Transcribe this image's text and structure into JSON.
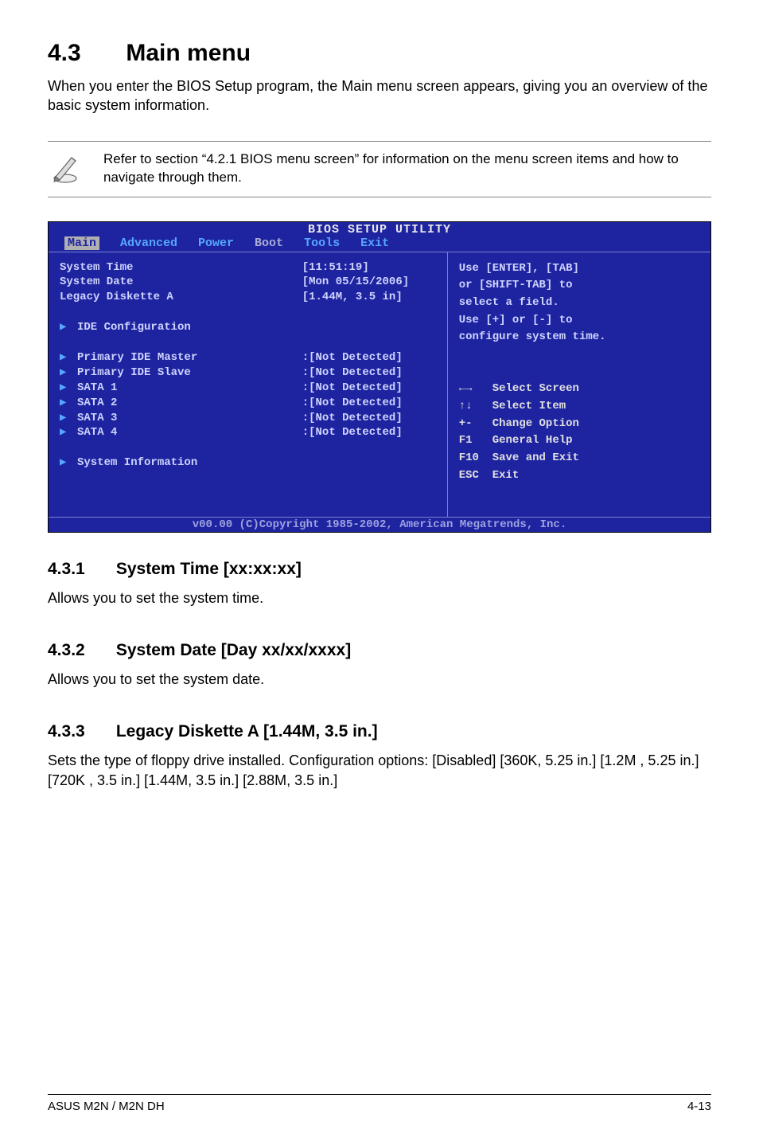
{
  "main": {
    "heading_num": "4.3",
    "heading_title": "Main menu",
    "intro": "When you enter the BIOS Setup program, the Main menu screen appears, giving you an overview of the basic system information."
  },
  "note": {
    "text": "Refer to section “4.2.1  BIOS menu screen” for information on the menu screen items and how to navigate through them."
  },
  "bios": {
    "title": "BIOS SETUP UTILITY",
    "tabs": [
      "Main",
      "Advanced",
      "Power",
      "Boot",
      "Tools",
      "Exit"
    ],
    "rows_top": [
      {
        "label": "System Time",
        "val": "[11:51:19]"
      },
      {
        "label": "System Date",
        "val": "[Mon 05/15/2006]"
      },
      {
        "label": "Legacy Diskette A",
        "val": "[1.44M, 3.5 in]"
      }
    ],
    "row_ide": {
      "label": "IDE Configuration"
    },
    "rows_dev": [
      {
        "label": "Primary IDE Master",
        "val": ":[Not Detected]"
      },
      {
        "label": "Primary IDE Slave",
        "val": ":[Not Detected]"
      },
      {
        "label": "SATA 1",
        "val": ":[Not Detected]"
      },
      {
        "label": "SATA 2",
        "val": ":[Not Detected]"
      },
      {
        "label": "SATA 3",
        "val": ":[Not Detected]"
      },
      {
        "label": "SATA 4",
        "val": ":[Not Detected]"
      }
    ],
    "row_sys": {
      "label": "System Information"
    },
    "help": {
      "lines": [
        "Use [ENTER], [TAB]",
        "or [SHIFT-TAB] to",
        "select a field.",
        "Use [+] or [-] to",
        "configure system time."
      ],
      "keys": [
        {
          "k": "←→",
          "d": "Select Screen"
        },
        {
          "k": "↑↓",
          "d": "Select Item"
        },
        {
          "k": "+-",
          "d": "Change Option"
        },
        {
          "k": "F1",
          "d": "General Help"
        },
        {
          "k": "F10",
          "d": "Save and Exit"
        },
        {
          "k": "ESC",
          "d": "Exit"
        }
      ]
    },
    "footer": "v00.00 (C)Copyright 1985-2002, American Megatrends, Inc."
  },
  "sections": [
    {
      "num": "4.3.1",
      "title": "System Time [xx:xx:xx]",
      "body": "Allows you to set the system time."
    },
    {
      "num": "4.3.2",
      "title": "System Date [Day xx/xx/xxxx]",
      "body": "Allows you to set the system date."
    },
    {
      "num": "4.3.3",
      "title": "Legacy Diskette A [1.44M, 3.5 in.]",
      "body": "Sets the type of floppy drive installed. Configuration options: [Disabled] [360K, 5.25 in.] [1.2M , 5.25 in.] [720K , 3.5 in.] [1.44M, 3.5 in.] [2.88M, 3.5 in.]"
    }
  ],
  "footer": {
    "left": "ASUS M2N / M2N DH",
    "right": "4-13"
  }
}
